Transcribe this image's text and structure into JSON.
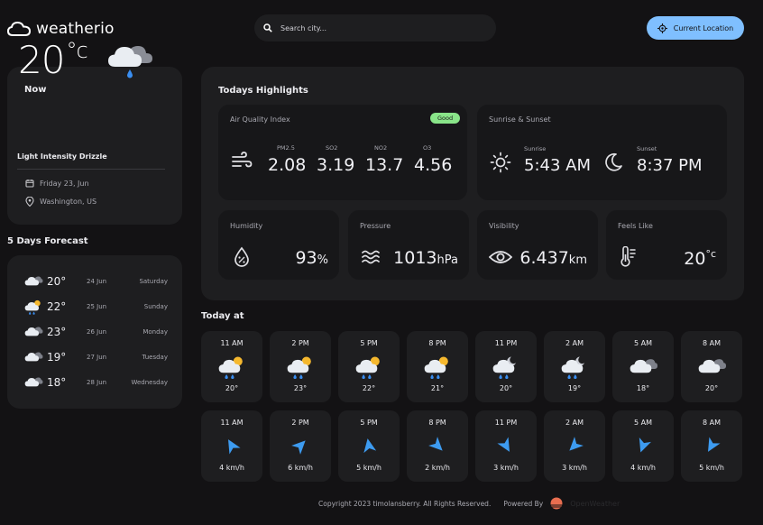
{
  "app": {
    "name": "weatherio"
  },
  "search": {
    "placeholder": "Search city..."
  },
  "header": {
    "location_button": "Current Location"
  },
  "now": {
    "label": "Now",
    "temp": "20",
    "unit": "°c",
    "description": "Light Intensity Drizzle",
    "date": "Friday 23, Jun",
    "location": "Washington, US",
    "icon": "cloud-drizzle-icon"
  },
  "forecast": {
    "title": "5 Days Forecast",
    "days": [
      {
        "icon": "cloud-icon",
        "temp": "20°",
        "date": "24 Jun",
        "day": "Saturday"
      },
      {
        "icon": "sun-cloud-rain-icon",
        "temp": "22°",
        "date": "25 Jun",
        "day": "Sunday"
      },
      {
        "icon": "cloud-icon",
        "temp": "23°",
        "date": "26 Jun",
        "day": "Monday"
      },
      {
        "icon": "cloud-icon",
        "temp": "19°",
        "date": "27 Jun",
        "day": "Tuesday"
      },
      {
        "icon": "cloud-icon",
        "temp": "18°",
        "date": "28 Jun",
        "day": "Wednesday"
      }
    ]
  },
  "highlights": {
    "title": "Todays Highlights",
    "air_quality": {
      "title": "Air Quality Index",
      "badge": "Good",
      "items": [
        {
          "label": "PM2.5",
          "value": "2.08"
        },
        {
          "label": "SO2",
          "value": "3.19"
        },
        {
          "label": "NO2",
          "value": "13.7"
        },
        {
          "label": "O3",
          "value": "4.56"
        }
      ]
    },
    "sun": {
      "title": "Sunrise & Sunset",
      "sunrise_label": "Sunrise",
      "sunrise": "5:43 AM",
      "sunset_label": "Sunset",
      "sunset": "8:37 PM"
    },
    "humidity": {
      "title": "Humidity",
      "value": "93",
      "unit": "%"
    },
    "pressure": {
      "title": "Pressure",
      "value": "1013",
      "unit": "hPa"
    },
    "visibility": {
      "title": "Visibility",
      "value": "6.437",
      "unit": "km"
    },
    "feels_like": {
      "title": "Feels Like",
      "value": "20",
      "unit": "°c"
    }
  },
  "today": {
    "title": "Today at",
    "hourly": [
      {
        "time": "11 AM",
        "temp": "20°",
        "icon": "sun-cloud-rain-icon",
        "wind": "4 km/h"
      },
      {
        "time": "2 PM",
        "temp": "23°",
        "icon": "sun-cloud-rain-icon",
        "wind": "6 km/h"
      },
      {
        "time": "5 PM",
        "temp": "22°",
        "icon": "sun-cloud-rain-icon",
        "wind": "5 km/h"
      },
      {
        "time": "8 PM",
        "temp": "21°",
        "icon": "sun-cloud-rain-icon",
        "wind": "2 km/h"
      },
      {
        "time": "11 PM",
        "temp": "20°",
        "icon": "moon-cloud-rain-icon",
        "wind": "3 km/h"
      },
      {
        "time": "2 AM",
        "temp": "19°",
        "icon": "moon-cloud-rain-icon",
        "wind": "3 km/h"
      },
      {
        "time": "5 AM",
        "temp": "18°",
        "icon": "cloud-icon",
        "wind": "4 km/h"
      },
      {
        "time": "8 AM",
        "temp": "20°",
        "icon": "cloud-icon",
        "wind": "5 km/h"
      }
    ]
  },
  "footer": {
    "copyright": "Copyright 2023 timolansberry. All Rights Reserved.",
    "powered_by": "Powered By",
    "brand": "OpenWeather"
  },
  "colors": {
    "background": "#131214",
    "card": "#1e1e20",
    "accent": "#7fbfff",
    "badge_good": "#89e589",
    "wind_arrow": "#3d9bf0"
  }
}
